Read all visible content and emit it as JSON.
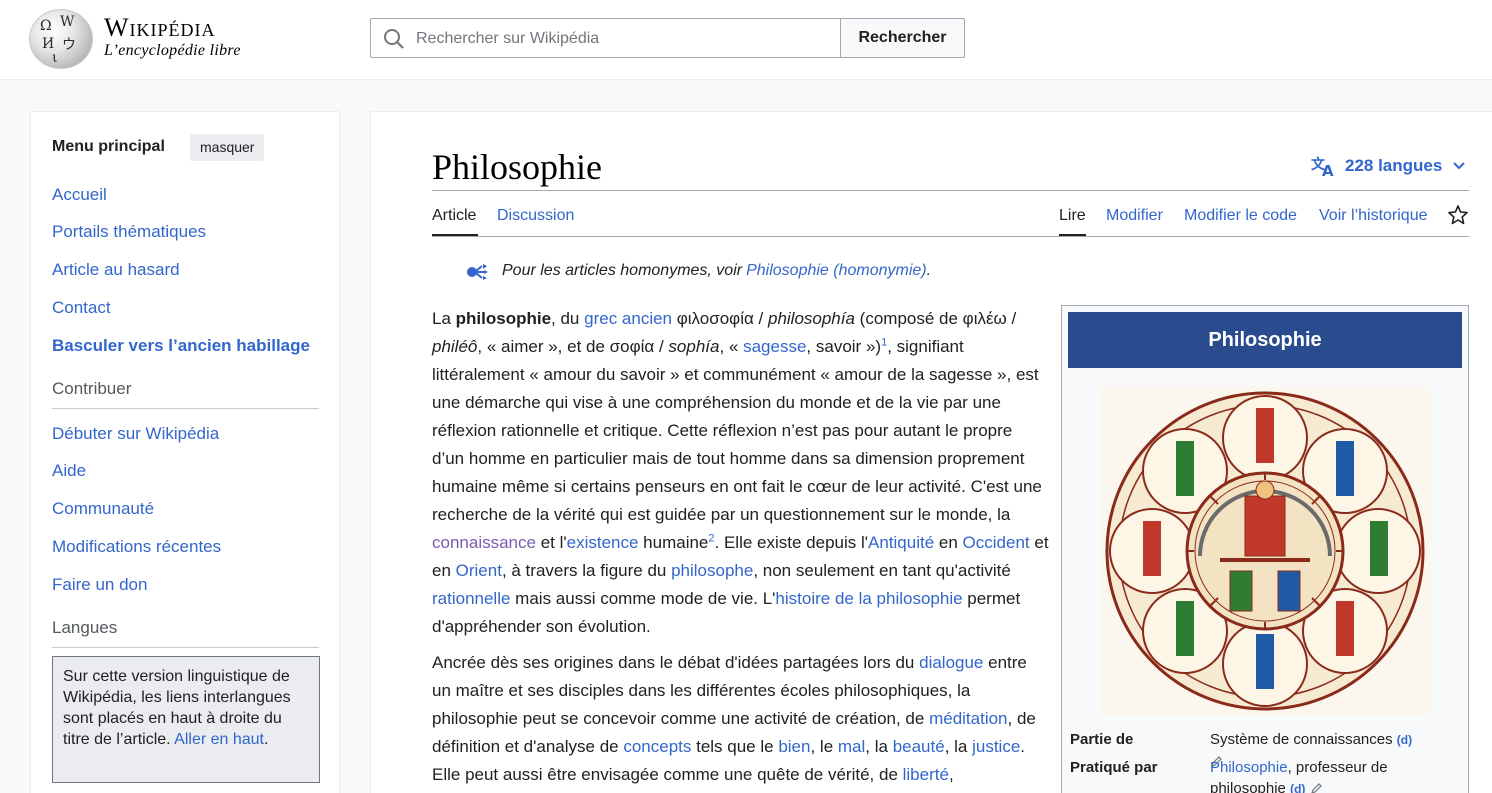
{
  "header": {
    "wordmark": "Wikipédia",
    "tagline": "L’encyclopédie libre",
    "search_placeholder": "Rechercher sur Wikipédia",
    "search_button": "Rechercher"
  },
  "sidebar": {
    "menu_title": "Menu principal",
    "hide_button": "masquer",
    "main_links": [
      "Accueil",
      "Portails thématiques",
      "Article au hasard",
      "Contact",
      "Basculer vers l’ancien habillage"
    ],
    "contribute_heading": "Contribuer",
    "contribute_links": [
      "Débuter sur Wikipédia",
      "Aide",
      "Communauté",
      "Modifications récentes",
      "Faire un don"
    ],
    "languages_heading": "Langues",
    "languages_note": "Sur cette version linguistique de Wikipédia, les liens interlangues sont placés en haut à droite du titre de l’article.",
    "languages_link": "Aller en haut",
    "languages_note_end": "."
  },
  "article": {
    "title": "Philosophie",
    "languages_button": "228 langues",
    "tabs_left": [
      "Article",
      "Discussion"
    ],
    "tabs_right": [
      "Lire",
      "Modifier",
      "Modifier le code",
      "Voir l’historique"
    ],
    "hatnote_text": "Pour les articles homonymes, voir ",
    "hatnote_link": "Philosophie (homonymie)",
    "hatnote_end": ".",
    "p1": {
      "t1": "La ",
      "b1": "philosophie",
      "t2": ", du ",
      "l1": "grec ancien",
      "t3": " φιλοσοφία / ",
      "i1": "philosophía",
      "t4": " (composé de φιλέω / ",
      "i2": "philéô",
      "t5": ", « aimer », et de σοφία / ",
      "i3": "sophía",
      "t6": ", « ",
      "l2": "sagesse",
      "t7": ", savoir »)",
      "s1": "1",
      "t8": ", signifiant littéralement « amour du savoir » et communément « amour de la sagesse », est une démarche qui vise à une compréhension du monde et de la vie par une réflexion rationnelle et critique. Cette réflexion n’est pas pour autant le propre d’un homme en particulier mais de tout homme dans sa dimension proprement humaine même si certains penseurs en ont fait le cœur de leur activité. C'est une recherche de la vérité qui est guidée par un questionnement sur le monde, la ",
      "l3": "connaissance",
      "t9": " et l'",
      "l4": "existence",
      "t10": " humaine",
      "s2": "2",
      "t11": ". Elle existe depuis l'",
      "l5": "Antiquité",
      "t12": " en ",
      "l6": "Occident",
      "t13": " et en ",
      "l7": "Orient",
      "t14": ", à travers la figure du ",
      "l8": "philosophe",
      "t15": ", non seulement en tant qu'activité ",
      "l9": "rationnelle",
      "t16": " mais aussi comme mode de vie. L'",
      "l10": "histoire de la philosophie",
      "t17": " permet d'appréhender son évolution."
    },
    "p2": {
      "t1": "Ancrée dès ses origines dans le débat d'idées partagées lors du ",
      "l1": "dialogue",
      "t2": " entre un maître et ses disciples dans les différentes écoles philosophiques, la philosophie peut se concevoir comme une activité de création, de ",
      "l2": "méditation",
      "t3": ", de définition et d'analyse de ",
      "l3": "concepts",
      "t4": " tels que le ",
      "l4": "bien",
      "t5": ", le ",
      "l5": "mal",
      "t6": ", la ",
      "l6": "beauté",
      "t7": ", la ",
      "l7": "justice",
      "t8": ". Elle peut aussi être envisagée comme une quête de vérité, de ",
      "l8": "liberté",
      "t9": ","
    }
  },
  "infobox": {
    "title": "Philosophie",
    "rows": [
      {
        "label": "Partie de",
        "value": "Système de connaissances",
        "wd": "(d)"
      },
      {
        "label": "Pratiqué par",
        "value_link": "Philosophie",
        "value_rest": ", professeur de philosophie",
        "wd": "(d)"
      }
    ]
  },
  "colors": {
    "link": "#3366cc",
    "visited_link": "#795cb2",
    "infobox_header": "#2a4b8d",
    "text": "#202122"
  }
}
